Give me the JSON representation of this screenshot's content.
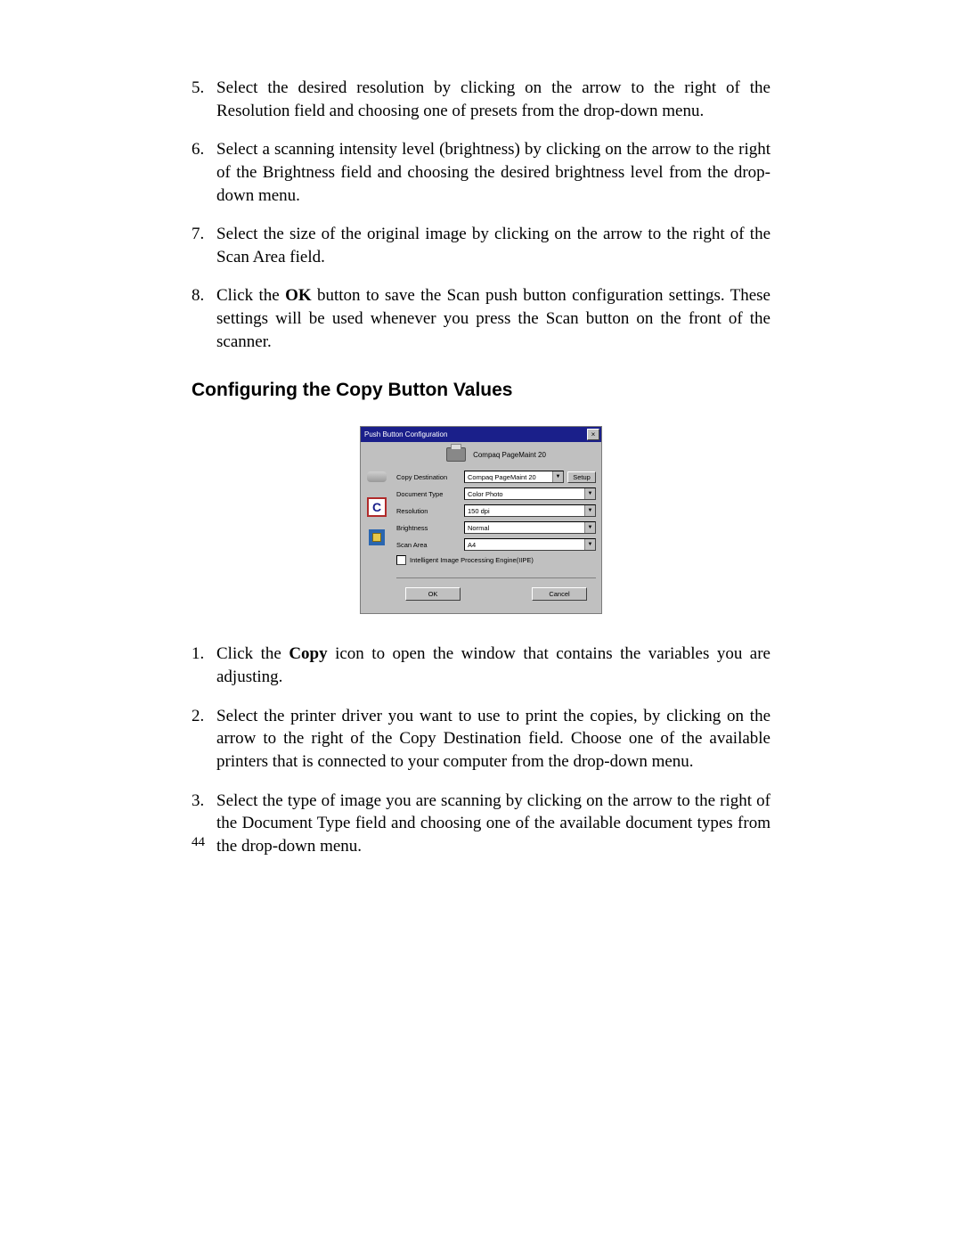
{
  "steps_top": [
    {
      "n": "5.",
      "parts": [
        {
          "t": "Select the desired resolution by clicking on the arrow to the right of the Resolution field and choosing one of presets from the drop-down menu."
        }
      ]
    },
    {
      "n": "6.",
      "parts": [
        {
          "t": "Select a scanning intensity level (brightness) by clicking on the arrow to the right of the Brightness field and choosing the desired brightness level from the drop-down menu."
        }
      ]
    },
    {
      "n": "7.",
      "parts": [
        {
          "t": "Select the size of the original image by clicking on the arrow to the right of the Scan Area field."
        }
      ]
    },
    {
      "n": "8.",
      "parts": [
        {
          "t": "Click the "
        },
        {
          "t": "OK",
          "b": true
        },
        {
          "t": " button to save the Scan push button configuration settings. These settings will be used whenever you press the Scan button on the front of the scanner."
        }
      ]
    }
  ],
  "section_heading": "Configuring the Copy Button Values",
  "dialog": {
    "title": "Push Button Configuration",
    "header_printer": "Compaq PageMaint 20",
    "rows": {
      "copy_dest_label": "Copy Destination",
      "copy_dest_value": "Compaq PageMaint 20",
      "setup": "Setup",
      "doc_type_label": "Document Type",
      "doc_type_value": "Color Photo",
      "resolution_label": "Resolution",
      "resolution_value": "150 dpi",
      "brightness_label": "Brightness",
      "brightness_value": "Normal",
      "scan_area_label": "Scan Area",
      "scan_area_value": "A4"
    },
    "iipe": "Intelligent Image Processing Engine(IIPE)",
    "ok": "OK",
    "cancel": "Cancel"
  },
  "steps_bottom": [
    {
      "n": "1.",
      "parts": [
        {
          "t": "Click the "
        },
        {
          "t": "Copy",
          "b": true
        },
        {
          "t": " icon to open the window that contains the variables you are adjusting."
        }
      ]
    },
    {
      "n": "2.",
      "parts": [
        {
          "t": "Select the printer driver you want to use to print the copies, by clicking on the arrow to the right of the Copy Destination field. Choose one of the available printers that is connected to your computer from the drop-down menu."
        }
      ]
    },
    {
      "n": "3.",
      "parts": [
        {
          "t": "Select the type of image you are scanning by clicking on the arrow to the right of the Document Type field and choosing one of the available document types from the drop-down menu."
        }
      ]
    }
  ],
  "page_number": "44"
}
